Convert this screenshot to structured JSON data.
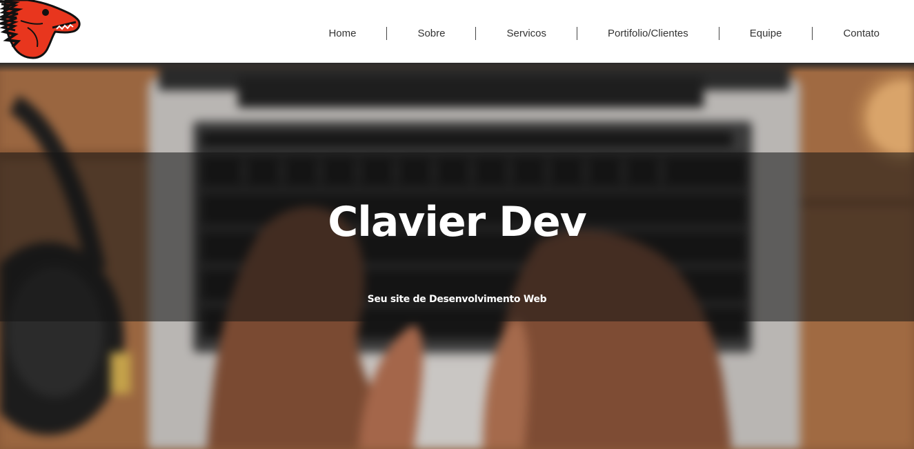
{
  "nav": {
    "items": [
      {
        "label": "Home"
      },
      {
        "label": "Sobre"
      },
      {
        "label": "Servicos"
      },
      {
        "label": "Portifolio/Clientes"
      },
      {
        "label": "Equipe"
      },
      {
        "label": "Contato"
      }
    ]
  },
  "hero": {
    "title": "Clavier Dev",
    "subtitle": "Seu site de Desenvolvimento Web"
  },
  "colors": {
    "logo_red": "#e8361e",
    "nav_text": "#333333"
  },
  "icons": {
    "logo": "dinosaur-head-logo"
  }
}
